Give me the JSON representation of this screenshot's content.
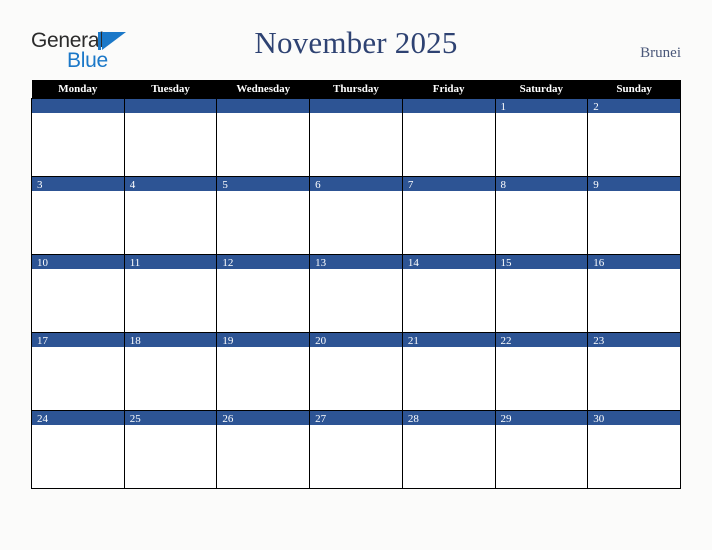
{
  "brand": {
    "name_part1": "General",
    "name_part2": "Blue",
    "triangle_color": "#1b78c8",
    "text_color": "#2b2b2b"
  },
  "header": {
    "title": "November 2025",
    "country": "Brunei",
    "title_color": "#2e4272",
    "country_color": "#4a5779"
  },
  "calendar": {
    "month": "November",
    "year": "2025",
    "weekday_headers": [
      "Monday",
      "Tuesday",
      "Wednesday",
      "Thursday",
      "Friday",
      "Saturday",
      "Sunday"
    ],
    "header_bg": "#000000",
    "header_text": "#ffffff",
    "day_bar_color": "#2d5494",
    "day_number_color": "#ffffff",
    "cell_bg": "#ffffff",
    "border_color": "#000000",
    "weeks": [
      [
        "",
        "",
        "",
        "",
        "",
        "1",
        "2"
      ],
      [
        "3",
        "4",
        "5",
        "6",
        "7",
        "8",
        "9"
      ],
      [
        "10",
        "11",
        "12",
        "13",
        "14",
        "15",
        "16"
      ],
      [
        "17",
        "18",
        "19",
        "20",
        "21",
        "22",
        "23"
      ],
      [
        "24",
        "25",
        "26",
        "27",
        "28",
        "29",
        "30"
      ]
    ]
  },
  "page": {
    "background": "#fbfbfa"
  }
}
